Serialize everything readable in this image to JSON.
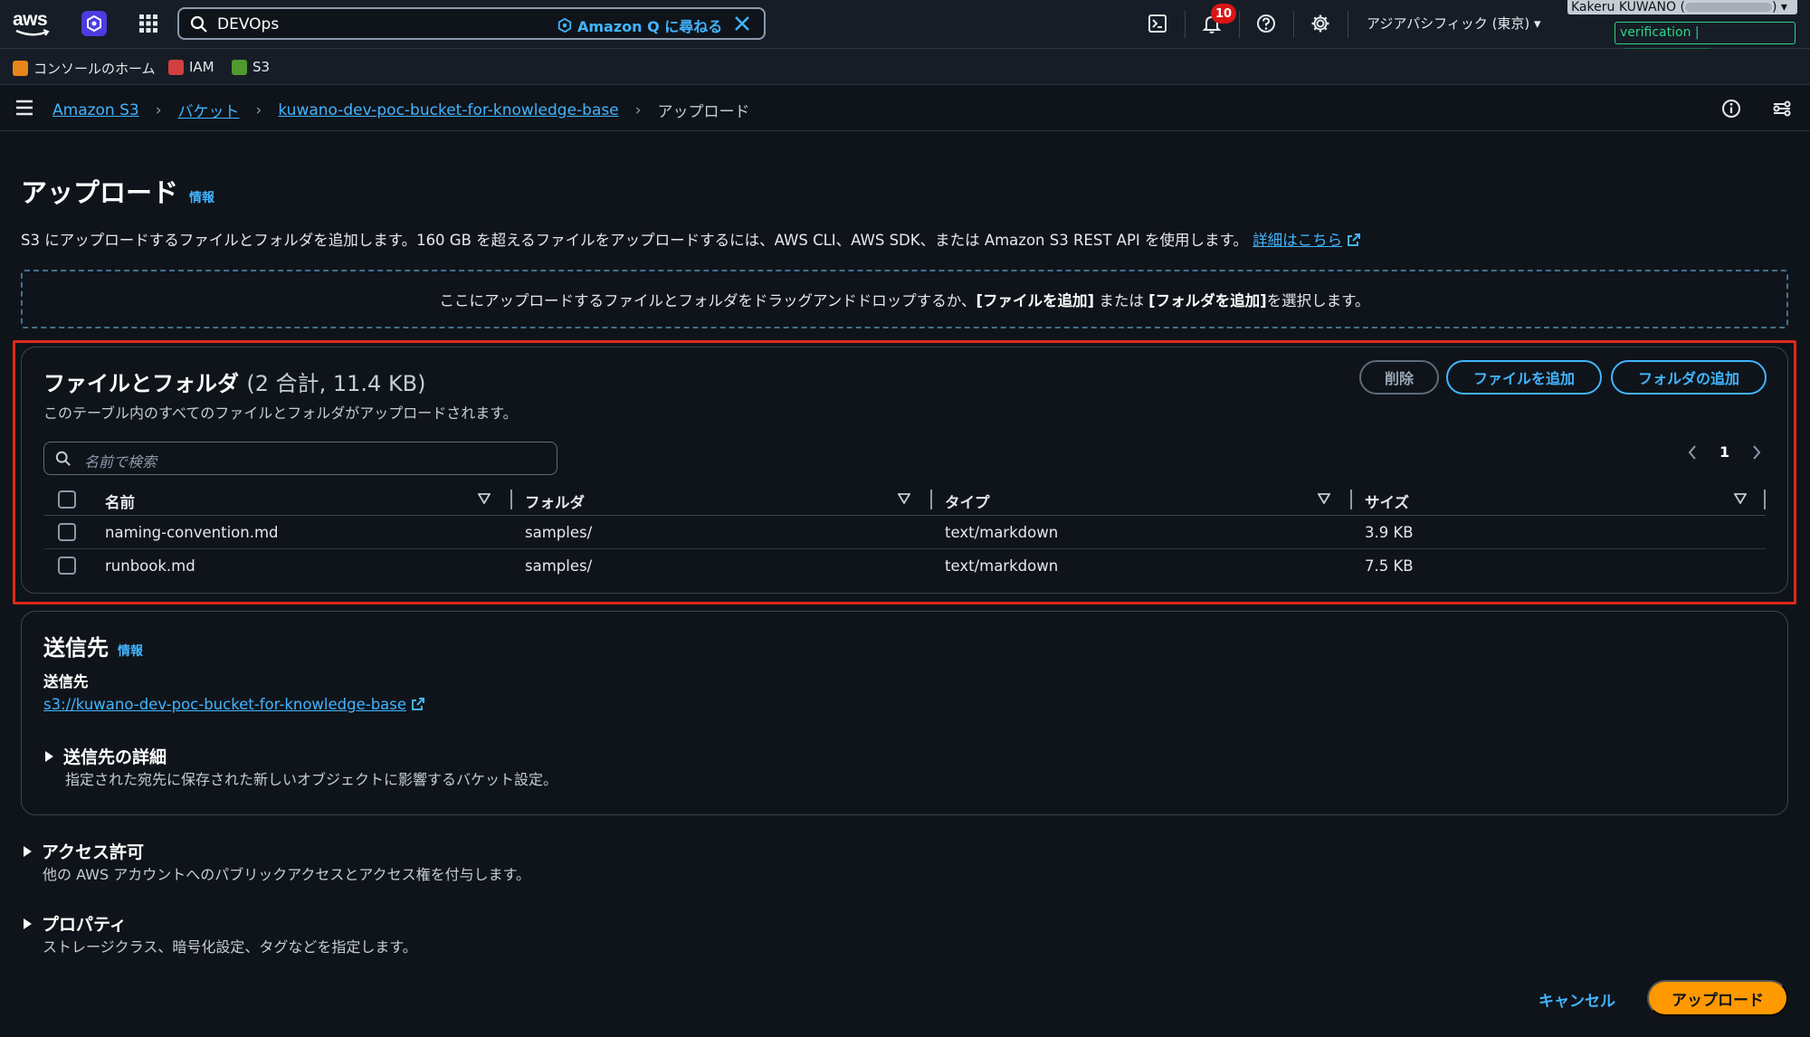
{
  "topnav": {
    "logo_text": "aws",
    "search_value": "DEVOps",
    "ask_q_label": "Amazon Q に尋ねる",
    "notification_count": "10",
    "region_label": "アジアパシフィック (東京) ▾",
    "account_name": "Kakeru KUWANO (",
    "account_suffix": ") ▾",
    "account_badge": "verification |",
    "icons": [
      "aws-logo",
      "amazon-q-icon",
      "apps-grid-icon",
      "search-icon",
      "close-icon",
      "cloudshell-icon",
      "bell-icon",
      "help-icon",
      "gear-icon"
    ]
  },
  "favorites": [
    {
      "label": "コンソールのホーム",
      "color": "#e8851a"
    },
    {
      "label": "IAM",
      "color": "#d13f3f"
    },
    {
      "label": "S3",
      "color": "#4f9a2f"
    }
  ],
  "breadcrumb": {
    "items": [
      "Amazon S3",
      "バケット",
      "kuwano-dev-poc-bucket-for-knowledge-base"
    ],
    "current": "アップロード"
  },
  "page": {
    "title": "アップロード",
    "info_label": "情報",
    "description": "S3 にアップロードするファイルとフォルダを追加します。160 GB を超えるファイルをアップロードするには、AWS CLI、AWS SDK、または Amazon S3 REST API を使用します。",
    "learn_more": "詳細はこちら",
    "dropzone_pre": "ここにアップロードするファイルとフォルダをドラッグアンドドロップするか、",
    "dropzone_b1": "[ファイルを追加]",
    "dropzone_mid": " または ",
    "dropzone_b2": "[フォルダを追加]",
    "dropzone_post": " を選択します。"
  },
  "files": {
    "title": "ファイルとフォルダ",
    "count": "(2 合計, 11.4 KB)",
    "subtitle": "このテーブル内のすべてのファイルとフォルダがアップロードされます。",
    "delete_label": "削除",
    "add_files_label": "ファイルを追加",
    "add_folder_label": "フォルダの追加",
    "search_placeholder": "名前で検索",
    "page_number": "1",
    "columns": [
      "名前",
      "フォルダ",
      "タイプ",
      "サイズ"
    ],
    "rows": [
      {
        "name": "naming-convention.md",
        "folder": "samples/",
        "type": "text/markdown",
        "size": "3.9 KB"
      },
      {
        "name": "runbook.md",
        "folder": "samples/",
        "type": "text/markdown",
        "size": "7.5 KB"
      }
    ]
  },
  "destination": {
    "title": "送信先",
    "info_label": "情報",
    "label": "送信先",
    "link": "s3://kuwano-dev-poc-bucket-for-knowledge-base",
    "details_title": "送信先の詳細",
    "details_desc": "指定された宛先に保存された新しいオブジェクトに影響するバケット設定。"
  },
  "permissions": {
    "title": "アクセス許可",
    "desc": "他の AWS アカウントへのパブリックアクセスとアクセス権を付与します。"
  },
  "properties": {
    "title": "プロパティ",
    "desc": "ストレージクラス、暗号化設定、タグなどを指定します。"
  },
  "footer": {
    "cancel_label": "キャンセル",
    "upload_label": "アップロード"
  },
  "colors": {
    "accent": "#42b4ff",
    "primary_button": "#ff9900",
    "highlight_border": "#e0281a",
    "background": "#0f141a"
  }
}
